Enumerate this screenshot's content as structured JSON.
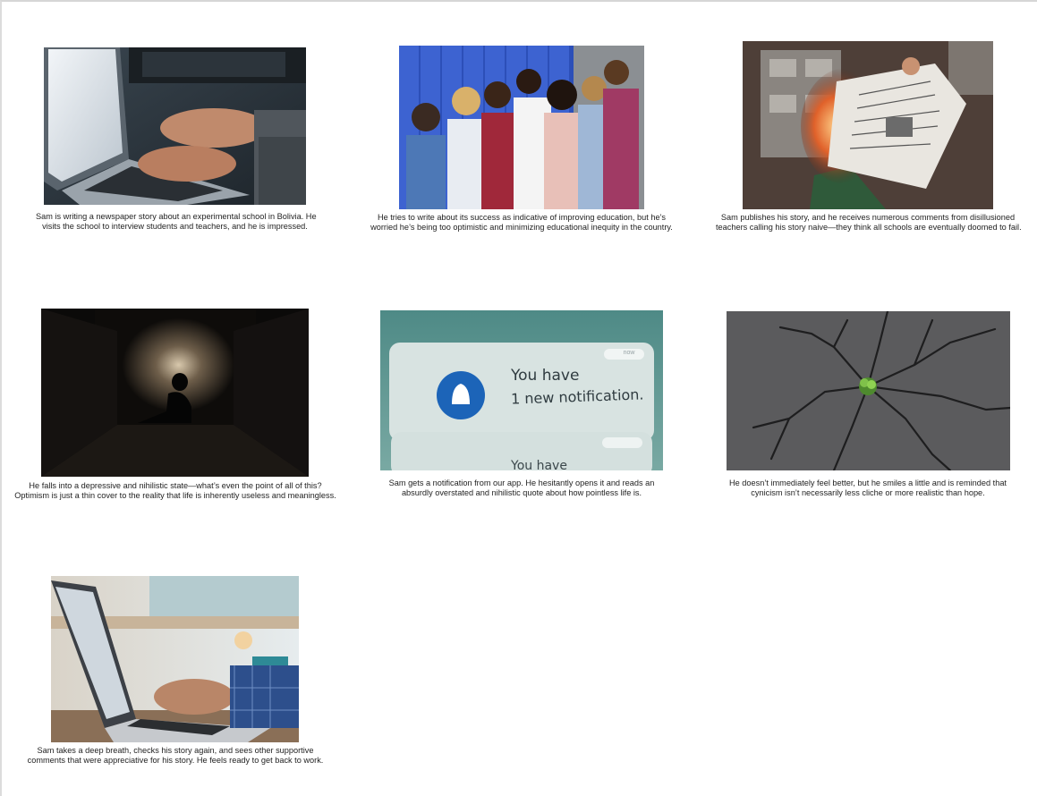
{
  "panels": [
    {
      "image": "laptop-typing-photo",
      "caption": [
        "Sam is writing a newspaper story about an experimental school in Bolivia. He",
        "visits the school to interview students and teachers, and he is impressed."
      ]
    },
    {
      "image": "students-by-lockers-photo",
      "caption": [
        "He tries to write about its success as indicative of improving education, but he’s",
        "worried he’s being too optimistic and minimizing educational inequity in the country."
      ]
    },
    {
      "image": "burning-newspaper-photo",
      "caption": [
        "Sam publishes his story, and he receives numerous comments from disillusioned",
        "teachers calling his story naive—they think all schools are eventually doomed to fail."
      ]
    },
    {
      "image": "sad-person-in-dark-hallway-photo",
      "caption": [
        "He falls into a depressive and nihilistic state—what’s even the point of all of this?",
        "Optimism is just a thin cover to the reality that life is inherently useless and meaningless."
      ]
    },
    {
      "image": "notification-screen-photo",
      "notification": {
        "badge": "now",
        "line1": "You have",
        "line2": "1 new notification.",
        "partial": "You have"
      },
      "caption": [
        "Sam gets a notification from our app. He hesitantly opens it and reads an",
        "absurdly overstated and nihilistic quote about how pointless life is."
      ]
    },
    {
      "image": "sprout-in-cracked-asphalt-photo",
      "caption": [
        "He doesn’t immediately feel better, but he smiles a little and is reminded that",
        "cynicism isn’t necessarily less cliche or more realistic than hope."
      ]
    },
    {
      "image": "laptop-work-desk-photo",
      "caption": [
        "Sam takes a deep breath, checks his story again, and sees other supportive",
        "comments that were appreciative for his story. He feels ready to get back to work."
      ]
    }
  ]
}
